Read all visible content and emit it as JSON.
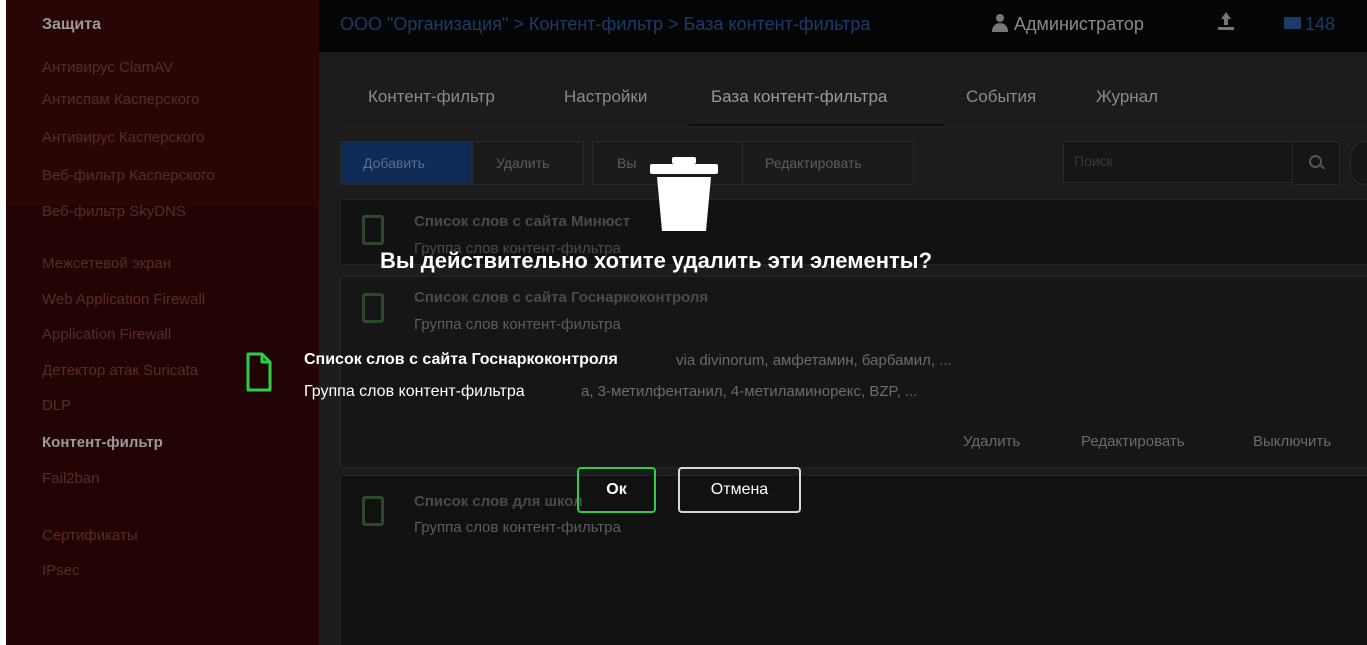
{
  "sidebar": {
    "section_title": "Защита",
    "items_top": [
      "Антивирус ClamAV",
      "Антиспам Касперского",
      "Антивирус Касперского",
      "Веб-фильтр Касперского",
      "Веб-фильтр SkyDNS"
    ],
    "items_mid": [
      "Межсетевой экран",
      "Web Application Firewall",
      "Application Firewall",
      "Детектор атак Suricata",
      "DLP",
      "Контент-фильтр",
      "Fail2ban"
    ],
    "items_bottom": [
      "Сертификаты",
      "IPsec"
    ],
    "active_item": "Контент-фильтр"
  },
  "header": {
    "breadcrumb": "ООО \"Организация\" > Контент-фильтр > База контент-фильтра",
    "user": "Администратор",
    "upload_icon": "upload-icon",
    "mail_count": "148"
  },
  "tabs": [
    "Контент-фильтр",
    "Настройки",
    "База контент-фильтра",
    "События",
    "Журнал"
  ],
  "active_tab": "База контент-фильтра",
  "toolbar": {
    "add": "Добавить",
    "delete": "Удалить",
    "disable_partial": "Вы",
    "edit": "Редактировать",
    "search_placeholder": "Поиск"
  },
  "list": [
    {
      "title": "Список слов с сайта Минюст",
      "subtitle": "Группа слов контент-фильтра"
    },
    {
      "title": "Список слов с сайта Госнаркоконтроля",
      "subtitle": "Группа слов контент-фильтра",
      "detail1": "via divinorum, амфетамин, барбамил, ...",
      "detail2": "а, 3-метилфентанил, 4-метиламинорекс, BZP, ...",
      "actions": [
        "Удалить",
        "Редактировать",
        "Выключить"
      ]
    },
    {
      "title": "Список слов для школ",
      "subtitle": "Группа слов контент-фильтра"
    }
  ],
  "dialog": {
    "icon": "trash-icon",
    "question": "Вы действительно хотите удалить эти элементы?",
    "item_title": "Список слов с сайта Госнаркоконтроля",
    "item_subtitle": "Группа слов контент-фильтра",
    "ok_label": "Ок",
    "cancel_label": "Отмена"
  },
  "colors": {
    "overlay": "#000000",
    "ok_border": "#2ad04a",
    "file_icon": "#2ad04a",
    "sidebar_ghost": "#2a0505"
  }
}
